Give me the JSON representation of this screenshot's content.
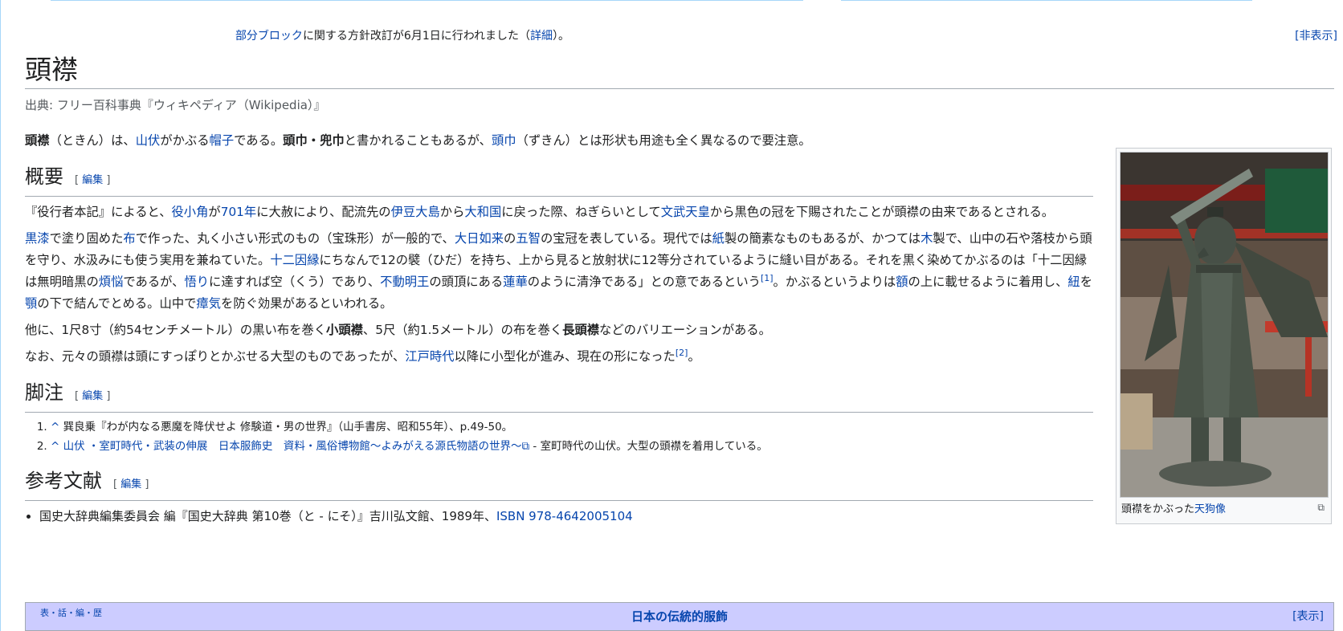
{
  "sitenotice": {
    "link1": "部分ブロック",
    "text1": "に関する方針改訂が6月1日に行われました（",
    "link2": "詳細",
    "text2": "）。",
    "hide": "[非表示]"
  },
  "page": {
    "title": "頭襟",
    "site_sub": "出典: フリー百科事典『ウィキペディア（Wikipedia）』"
  },
  "intro": [
    {
      "t": "頭襟",
      "b": true
    },
    {
      "t": "（ときん）は、"
    },
    {
      "t": "山伏",
      "l": true
    },
    {
      "t": "がかぶる"
    },
    {
      "t": "帽子",
      "l": true
    },
    {
      "t": "である。"
    },
    {
      "t": "頭巾・兜巾",
      "b": true
    },
    {
      "t": "と書かれることもあるが、"
    },
    {
      "t": "頭巾",
      "l": true
    },
    {
      "t": "（ずきん）とは形状も用途も全く異なるので要注意。"
    }
  ],
  "edit_label": "編集",
  "sections": {
    "overview": {
      "heading": "概要",
      "paragraphs": [
        [
          {
            "t": "『役行者本記』によると、"
          },
          {
            "t": "役小角",
            "l": true
          },
          {
            "t": "が"
          },
          {
            "t": "701年",
            "l": true
          },
          {
            "t": "に大赦により、配流先の"
          },
          {
            "t": "伊豆大島",
            "l": true
          },
          {
            "t": "から"
          },
          {
            "t": "大和国",
            "l": true
          },
          {
            "t": "に戻った際、ねぎらいとして"
          },
          {
            "t": "文武天皇",
            "l": true
          },
          {
            "t": "から黒色の冠を下賜されたことが頭襟の由来であるとされる。"
          }
        ],
        [
          {
            "t": "黒漆",
            "l": true
          },
          {
            "t": "で塗り固めた"
          },
          {
            "t": "布",
            "l": true
          },
          {
            "t": "で作った、丸く小さい形式のもの（宝珠形）が一般的で、"
          },
          {
            "t": "大日如来",
            "l": true
          },
          {
            "t": "の"
          },
          {
            "t": "五智",
            "l": true
          },
          {
            "t": "の宝冠を表している。現代では"
          },
          {
            "t": "紙",
            "l": true
          },
          {
            "t": "製の簡素なものもあるが、かつては"
          },
          {
            "t": "木",
            "l": true
          },
          {
            "t": "製で、山中の石や落枝から頭を守り、水汲みにも使う実用を兼ねていた。"
          },
          {
            "t": "十二因縁",
            "l": true
          },
          {
            "t": "にちなんで12の襞（ひだ）を持ち、上から見ると放射状に12等分されているように縫い目がある。それを黒く染めてかぶるのは「十二因縁は無明暗黒の"
          },
          {
            "t": "煩悩",
            "l": true
          },
          {
            "t": "であるが、"
          },
          {
            "t": "悟り",
            "l": true
          },
          {
            "t": "に達すれば空（くう）であり、"
          },
          {
            "t": "不動明王",
            "l": true
          },
          {
            "t": "の頭頂にある"
          },
          {
            "t": "蓮華",
            "l": true
          },
          {
            "t": "のように清浄である」との意であるという"
          },
          {
            "t": "[1]",
            "l": true,
            "sup": true
          },
          {
            "t": "。かぶるというよりは"
          },
          {
            "t": "額",
            "l": true
          },
          {
            "t": "の上に載せるように着用し、"
          },
          {
            "t": "紐",
            "l": true
          },
          {
            "t": "を"
          },
          {
            "t": "顎",
            "l": true
          },
          {
            "t": "の下で結んでとめる。山中で"
          },
          {
            "t": "瘴気",
            "l": true
          },
          {
            "t": "を防ぐ効果があるといわれる。"
          }
        ],
        [
          {
            "t": "他に、1尺8寸（約54センチメートル）の黒い布を巻く"
          },
          {
            "t": "小頭襟",
            "b": true
          },
          {
            "t": "、5尺（約1.5メートル）の布を巻く"
          },
          {
            "t": "長頭襟",
            "b": true
          },
          {
            "t": "などのバリエーションがある。"
          }
        ],
        [
          {
            "t": "なお、元々の頭襟は頭にすっぽりとかぶせる大型のものであったが、"
          },
          {
            "t": "江戸時代",
            "l": true
          },
          {
            "t": "以降に小型化が進み、現在の形になった"
          },
          {
            "t": "[2]",
            "l": true,
            "sup": true
          },
          {
            "t": "。"
          }
        ]
      ]
    },
    "notes": {
      "heading": "脚注",
      "items": [
        [
          {
            "t": "^",
            "l": true
          },
          {
            "t": " 巽良乗『わが内なる悪魔を降伏せよ 修験道・男の世界』（山手書房、昭和55年）、p.49-50。"
          }
        ],
        [
          {
            "t": "^",
            "l": true
          },
          {
            "t": " "
          },
          {
            "t": "山伏 ・室町時代・武装の伸展　日本服飾史　資料・風俗博物館〜よみがえる源氏物語の世界〜",
            "l": true
          },
          {
            "t": "⧉",
            "l": true
          },
          {
            "t": " - 室町時代の山伏。大型の頭襟を着用している。"
          }
        ]
      ]
    },
    "refs": {
      "heading": "参考文献",
      "items": [
        [
          {
            "t": "国史大辞典編集委員会 編『国史大辞典 第10巻（と - にそ）』吉川弘文館、1989年、"
          },
          {
            "t": "ISBN 978-4642005104",
            "l": true
          }
        ]
      ]
    }
  },
  "thumb": {
    "caption_text": "頭襟をかぶった",
    "caption_link": "天狗像",
    "magnify": "⧉"
  },
  "navbox": {
    "vte": "表・話・編・歴",
    "title": "日本の伝統的服飾",
    "show": "[表示]"
  }
}
